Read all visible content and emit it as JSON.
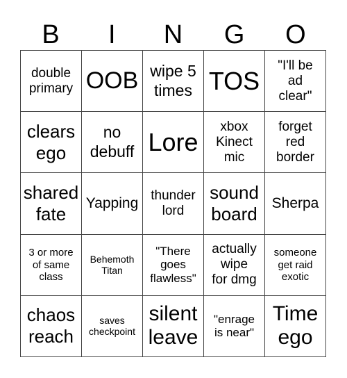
{
  "header": [
    "B",
    "I",
    "N",
    "G",
    "O"
  ],
  "cells": [
    [
      "double\nprimary",
      "OOB",
      "wipe 5\ntimes",
      "TOS",
      "\"I'll be\nad\nclear\""
    ],
    [
      "clears\nego",
      "no\ndebuff",
      "Lore",
      "xbox\nKinect\nmic",
      "forget\nred\nborder"
    ],
    [
      "shared\nfate",
      "Yapping",
      "thunder\nlord",
      "sound\nboard",
      "Sherpa"
    ],
    [
      "3 or more\nof same\nclass",
      "Behemoth\nTitan",
      "\"There\ngoes\nflawless\"",
      "actually\nwipe\nfor dmg",
      "someone\nget raid\nexotic"
    ],
    [
      "chaos\nreach",
      "saves\ncheckpoint",
      "silent\nleave",
      "\"enrage\nis near\"",
      "Time\nego"
    ]
  ]
}
